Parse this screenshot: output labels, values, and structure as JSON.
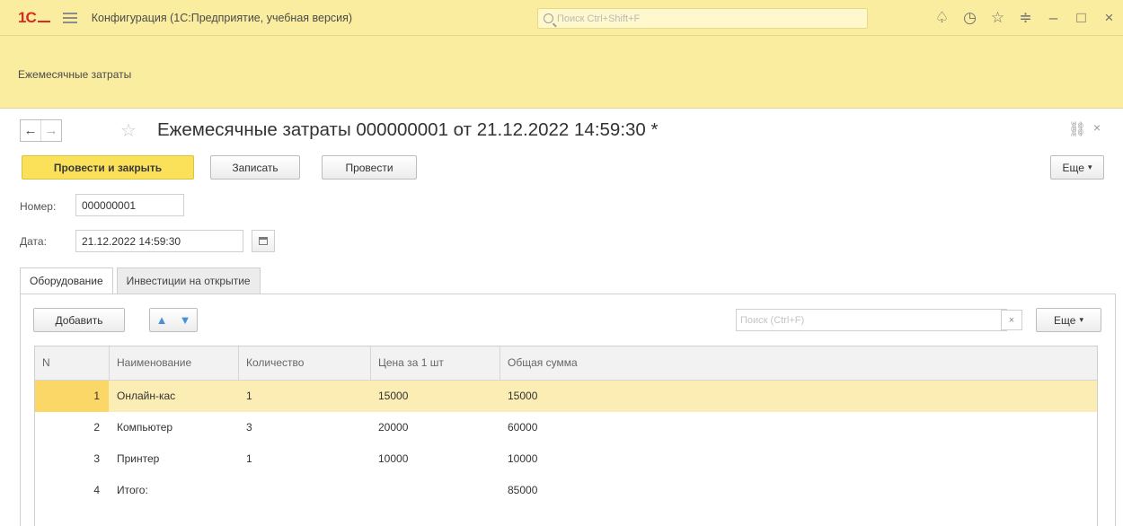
{
  "app": {
    "logo": "1С",
    "title": "Конфигурация  (1С:Предприятие, учебная версия)",
    "search_placeholder": "Поиск Ctrl+Shift+F"
  },
  "section": {
    "link": "Ежемесячные затраты"
  },
  "form": {
    "title": "Ежемесячные затраты 000000001 от 21.12.2022 14:59:30 *",
    "buttons": {
      "post_close": "Провести и закрыть",
      "save": "Записать",
      "post": "Провести",
      "more": "Еще"
    },
    "number_label": "Номер:",
    "number_value": "000000001",
    "date_label": "Дата:",
    "date_value": "21.12.2022 14:59:30"
  },
  "tabs": [
    {
      "label": "Оборудование",
      "active": true
    },
    {
      "label": "Инвестиции на открытие",
      "active": false
    }
  ],
  "table_bar": {
    "add": "Добавить",
    "search_placeholder": "Поиск (Ctrl+F)",
    "clear": "×",
    "more": "Еще"
  },
  "table": {
    "headers": [
      "N",
      "Наименование",
      "Количество",
      "Цена за 1 шт",
      "Общая сумма"
    ],
    "rows": [
      {
        "n": "1",
        "name": "Онлайн-кас",
        "qty": "1",
        "price": "15000",
        "total": "15000",
        "selected": true
      },
      {
        "n": "2",
        "name": "Компьютер",
        "qty": "3",
        "price": "20000",
        "total": "60000",
        "selected": false
      },
      {
        "n": "3",
        "name": "Принтер",
        "qty": "1",
        "price": "10000",
        "total": "10000",
        "selected": false
      },
      {
        "n": "4",
        "name": "Итого:",
        "qty": "",
        "price": "",
        "total": "85000",
        "selected": false
      }
    ]
  },
  "icons": {
    "hamburger": "menu-icon",
    "bell": "bell-icon",
    "history": "history-icon",
    "favorite": "star-icon",
    "settings": "settings-icon",
    "minimize": "minimize-icon",
    "maximize": "maximize-icon",
    "close": "close-icon"
  },
  "colors": {
    "header_bg": "#fbeda0",
    "primary_button": "#fbe05a",
    "selected_row": "#fbedb3",
    "logo_red": "#d62b1f",
    "arrow_blue": "#4a90d9"
  }
}
